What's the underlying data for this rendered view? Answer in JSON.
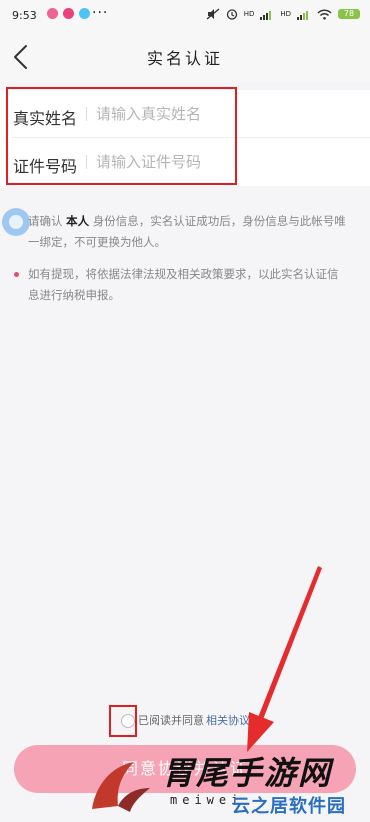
{
  "status_bar": {
    "time": "9:53",
    "dots": "···",
    "network_hd_1": "HD",
    "network_hd_2": "HD",
    "battery": "78"
  },
  "nav": {
    "title": "实名认证"
  },
  "form": {
    "name_label": "真实姓名",
    "name_placeholder": "请输入真实姓名",
    "id_label": "证件号码",
    "id_placeholder": "请输入证件号码"
  },
  "notices": {
    "n1_prefix": "请确认",
    "n1_bold": "本人",
    "n1_line1_rest": "身份信息，实名认证成功后，身份信息与此帐号唯",
    "n1_line2": "一绑定，不可更换为他人。",
    "n2_line1": "如有提现，将依据法律法规及相关政策要求，以此实名认证信",
    "n2_line2": "息进行纳税申报。"
  },
  "agreement": {
    "text": "已阅读并同意",
    "link": "相关协议"
  },
  "submit": {
    "label": "同意协议并认证"
  },
  "watermark": {
    "main": "胃尾手游网",
    "url": "meiwei",
    "sub": "云之居软件园"
  },
  "colors": {
    "accent_pink": "#f5a3b5",
    "bullet_pink": "#e84e72",
    "highlight_red": "#e02020",
    "link_blue": "#4a6ea8"
  }
}
